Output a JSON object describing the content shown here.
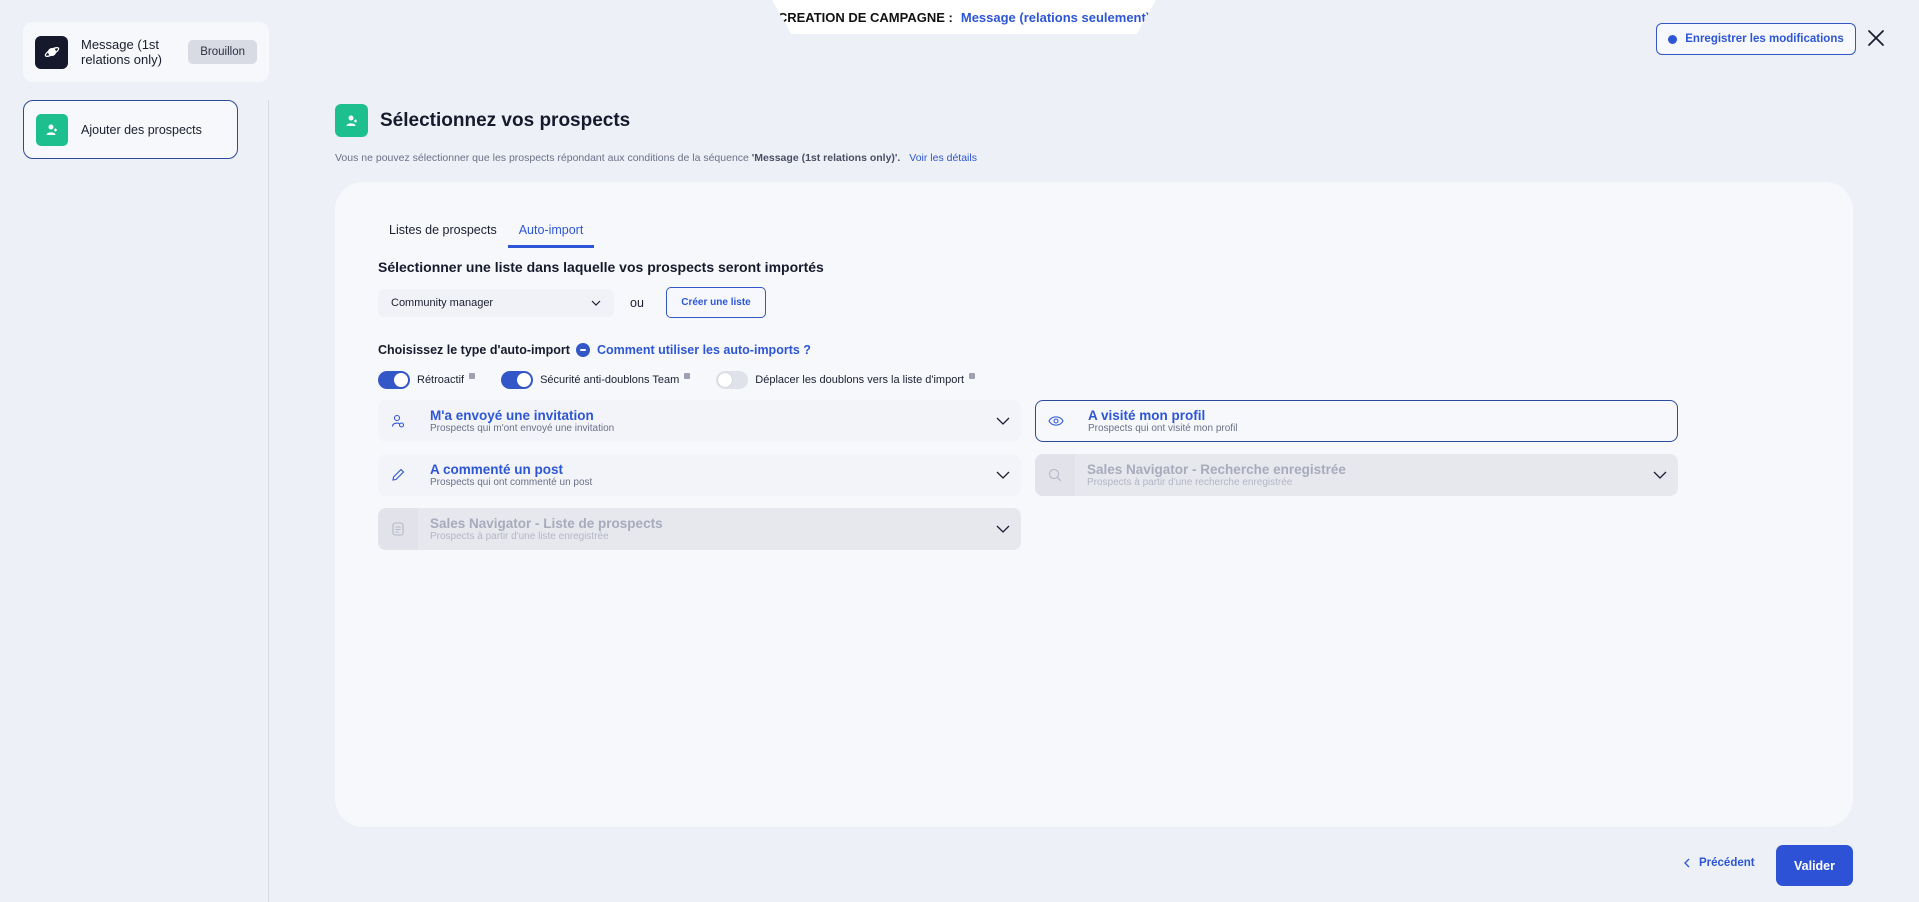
{
  "header": {
    "campaign_label": "CREATION DE CAMPAGNE :",
    "campaign_value": "Message (relations seulement)",
    "save_button": "Enregistrer les modifications",
    "close_icon": "close-icon"
  },
  "sidebar": {
    "campaign": {
      "name": "Message (1st relations only)",
      "status": "Brouillon",
      "icon": "planet-icon"
    },
    "steps": [
      {
        "label": "Ajouter des prospects",
        "icon": "user-add-icon"
      }
    ]
  },
  "main": {
    "title": "Sélectionnez vos prospects",
    "subtitle_prefix": "Vous ne pouvez sélectionner que les prospects répondant aux conditions de la séquence",
    "subtitle_sequence": "'Message (1st relations only)'.",
    "subtitle_link": "Voir les détails",
    "tabs": [
      {
        "label": "Listes de prospects",
        "active": false
      },
      {
        "label": "Auto-import",
        "active": true
      }
    ],
    "list_section_title": "Sélectionner une liste dans laquelle vos prospects seront importés",
    "list_select_value": "Community manager",
    "or_label": "ou",
    "create_list_button": "Créer une liste",
    "type_title": "Choisissez le type d'auto-import",
    "help_link": "Comment utiliser les auto-imports ?",
    "toggles": [
      {
        "label": "Rétroactif",
        "on": true
      },
      {
        "label": "Sécurité anti-doublons Team",
        "on": true
      },
      {
        "label": "Déplacer les doublons vers la liste d'import",
        "on": false
      }
    ],
    "options": [
      {
        "title": "M'a envoyé une invitation",
        "desc": "Prospects qui m'ont envoyé une invitation",
        "icon": "user-invite-icon",
        "state": "default"
      },
      {
        "title": "A visité mon profil",
        "desc": "Prospects qui ont visité mon profil",
        "icon": "eye-icon",
        "state": "selected"
      },
      {
        "title": "A commenté un post",
        "desc": "Prospects qui ont commenté un post",
        "icon": "pencil-icon",
        "state": "default"
      },
      {
        "title": "Sales Navigator - Recherche enregistrée",
        "desc": "Prospects à partir d'une recherche enregistrée",
        "icon": "search-icon",
        "state": "disabled"
      },
      {
        "title": "Sales Navigator - Liste de prospects",
        "desc": "Prospects à partir d'une liste enregistrée",
        "icon": "list-icon",
        "state": "disabled"
      }
    ]
  },
  "footer": {
    "previous_button": "Précédent",
    "validate_button": "Valider"
  },
  "colors": {
    "accent": "#2d56d6",
    "success": "#1dbf8f",
    "background": "#eef0f7"
  }
}
